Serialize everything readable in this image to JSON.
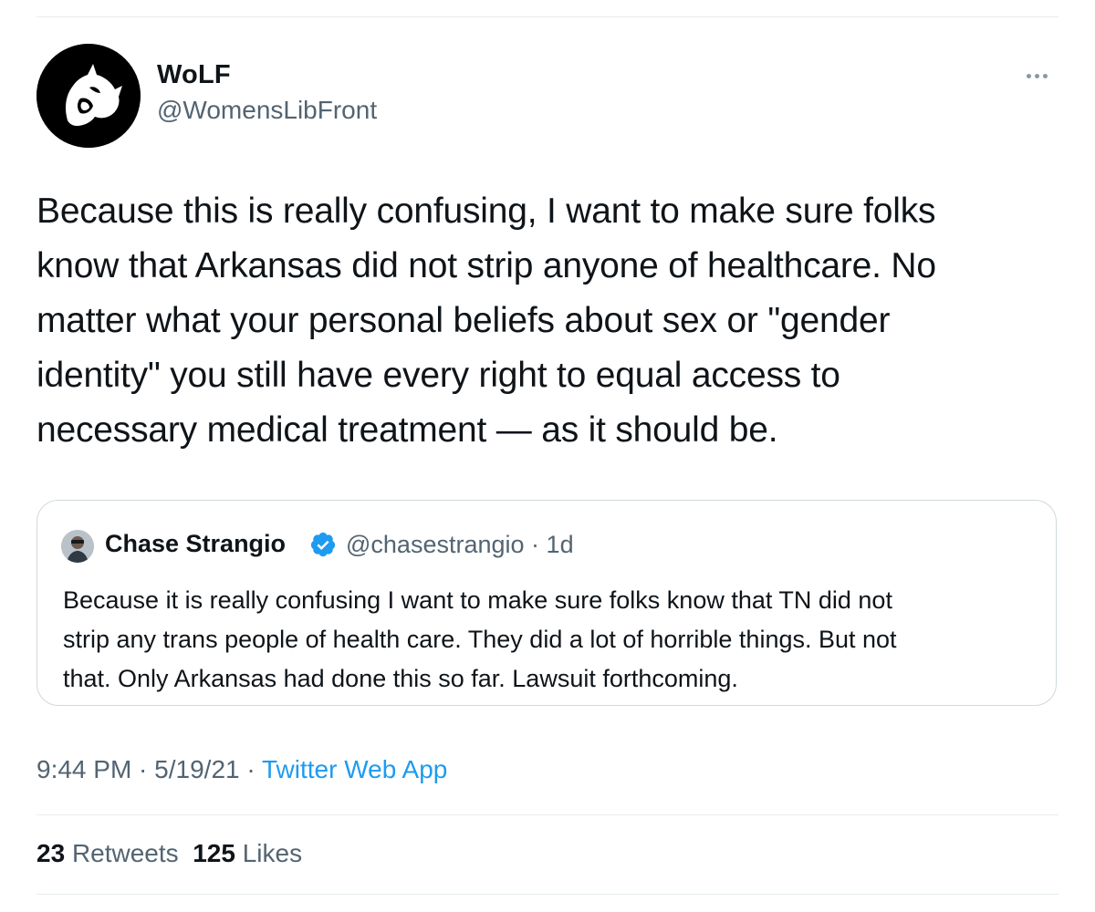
{
  "tweet": {
    "display_name": "WoLF",
    "handle": "@WomensLibFront",
    "text": "Because this is really confusing, I want to make sure folks\nknow that Arkansas did not strip anyone of healthcare. No\nmatter what your personal beliefs about sex or \"gender\nidentity\" you still have every right to equal access to\nnecessary medical treatment — as it should be.",
    "more_icon": "more-horizontal-icon",
    "avatar_icon": "wolf-logo-icon"
  },
  "quote": {
    "display_name": "Chase Strangio",
    "verified_icon": "verified-badge-icon",
    "handle": "@chasestrangio",
    "separator": "·",
    "time": "1d",
    "text": "Because it is really confusing I want to make sure folks know that TN did not\nstrip any trans people of health care. They did a lot of horrible things. But not\nthat. Only Arkansas had done this so far. Lawsuit forthcoming."
  },
  "meta": {
    "time": "9:44 PM",
    "sep1": " · ",
    "date": "5/19/21",
    "sep2": " · ",
    "source": "Twitter Web App"
  },
  "stats": {
    "retweets_count": "23",
    "retweets_label": "Retweets",
    "likes_count": "125",
    "likes_label": "Likes"
  },
  "colors": {
    "accent": "#1d9bf0",
    "verified": "#1d9bf0",
    "text_primary": "#0f1419",
    "text_secondary": "#536471",
    "border": "#cfd9de"
  }
}
